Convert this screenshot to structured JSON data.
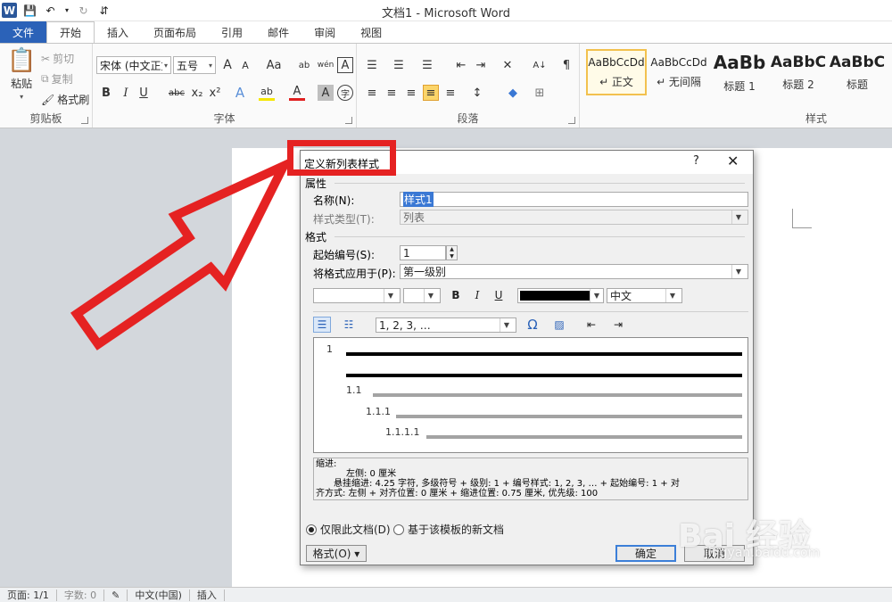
{
  "window": {
    "title": "文档1 - Microsoft Word",
    "qat": {
      "app_icon": "W",
      "save": "💾",
      "undo": "↶",
      "undo_caret": "▾",
      "redo": "↻",
      "customize": "⇵"
    }
  },
  "tabs": [
    "文件",
    "开始",
    "插入",
    "页面布局",
    "引用",
    "邮件",
    "审阅",
    "视图"
  ],
  "ribbon": {
    "clipboard": {
      "label": "剪贴板",
      "paste": "粘贴",
      "cut": "剪切",
      "copy": "复制",
      "format_painter": "格式刷"
    },
    "font": {
      "label": "字体",
      "font_name": "宋体 (中文正文)",
      "font_size": "五号",
      "grow": "A",
      "shrink": "A",
      "case": "Aa",
      "clear": "ab",
      "phonetic": "wén",
      "border_char": "A",
      "bold": "B",
      "italic": "I",
      "underline": "U",
      "strike": "abc",
      "sub": "x₂",
      "sup": "x²",
      "effects": "A",
      "highlight": "ab",
      "font_color": "A",
      "shading_char": "A",
      "enclose": "字"
    },
    "paragraph": {
      "label": "段落",
      "bullets": "☰",
      "numbering": "☰",
      "multilevel": "☰",
      "decrease_indent": "⇤",
      "increase_indent": "⇥",
      "chinese_layout": "✕",
      "sort": "A↓",
      "show_marks": "¶",
      "align_left": "≡",
      "center": "≡",
      "align_right": "≡",
      "justify": "≡",
      "distributed": "≡",
      "line_spacing": "↕",
      "shading": "◆",
      "borders": "⊞"
    },
    "styles": {
      "label": "样式",
      "items": [
        {
          "sample": "AaBbCcDd",
          "name": "↵ 正文"
        },
        {
          "sample": "AaBbCcDd",
          "name": "↵ 无间隔"
        },
        {
          "sample": "AaBb",
          "name": "标题 1"
        },
        {
          "sample": "AaBbC",
          "name": "标题 2"
        },
        {
          "sample": "AaBbC",
          "name": "标题"
        }
      ]
    }
  },
  "dialog": {
    "title": "定义新列表样式",
    "help": "?",
    "close": "✕",
    "properties_header": "属性",
    "name_label": "名称(N):",
    "name_value": "样式1",
    "style_type_label": "样式类型(T):",
    "style_type_value": "列表",
    "format_header": "格式",
    "start_label": "起始编号(S):",
    "start_value": "1",
    "apply_label": "将格式应用于(P):",
    "apply_value": "第一级别",
    "font_value": "",
    "size_value": "",
    "bold": "B",
    "italic": "I",
    "underline": "U",
    "language_value": "中文",
    "numbering_format": "1, 2, 3, …",
    "symbol": "Ω",
    "picture": "▨",
    "indent_dec": "⇤",
    "indent_inc": "⇥",
    "preview_numbers": [
      "1",
      "1.1",
      "1.1.1",
      "1.1.1.1"
    ],
    "description_lines": [
      "缩进:",
      "    左侧:  0 厘米",
      "    悬挂缩进: 4.25 字符, 多级符号 + 级别: 1 + 编号样式: 1, 2, 3, … + 起始编号: 1 + 对",
      "齐方式: 左侧 + 对齐位置:  0 厘米 + 缩进位置:  0.75 厘米, 优先级: 100"
    ],
    "radio_this_doc": "仅限此文档(D)",
    "radio_template": "基于该模板的新文档",
    "format_button": "格式(O) ▾",
    "ok": "确定",
    "cancel": "取消"
  },
  "status": {
    "page": "页面: 1/1",
    "words": "字数: 0",
    "language": "中文(中国)",
    "mode": "插入"
  },
  "watermark": {
    "brand": "Bai 经验",
    "domain": "jingyan.baidu.com"
  },
  "colors": {
    "file_tab": "#2b62b8",
    "annotation": "#e52222",
    "ok_border": "#3c7fd8"
  }
}
